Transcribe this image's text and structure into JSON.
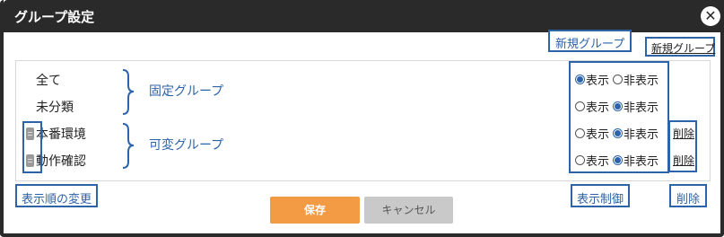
{
  "dialog": {
    "title": "グループ設定",
    "close_symbol": "✕"
  },
  "toolbar": {
    "new_group_link": "新規グループ"
  },
  "groups": [
    {
      "name": "全て",
      "show_label": "表示",
      "hide_label": "非表示",
      "selected": "show",
      "draggable": false,
      "delete": ""
    },
    {
      "name": "未分類",
      "show_label": "表示",
      "hide_label": "非表示",
      "selected": "hide",
      "draggable": false,
      "delete": ""
    },
    {
      "name": "本番環境",
      "show_label": "表示",
      "hide_label": "非表示",
      "selected": "hide",
      "draggable": true,
      "delete": "削除"
    },
    {
      "name": "動作確認",
      "show_label": "表示",
      "hide_label": "非表示",
      "selected": "hide",
      "draggable": true,
      "delete": "削除"
    }
  ],
  "annotations": {
    "fixed_groups": "固定グループ",
    "variable_groups": "可変グループ",
    "new_group": "新規グループ",
    "reorder": "表示順の変更",
    "visibility_control": "表示制御",
    "delete": "削除"
  },
  "footer": {
    "save_label": "保存",
    "cancel_label": "キャンセル"
  },
  "colors": {
    "titlebar": "#2a2a2a",
    "annotation": "#2d63a8",
    "save_button": "#f39a44",
    "cancel_button": "#c9c9c9"
  },
  "icons": {
    "close": "close-icon",
    "drag": "drag-handle-icon"
  }
}
